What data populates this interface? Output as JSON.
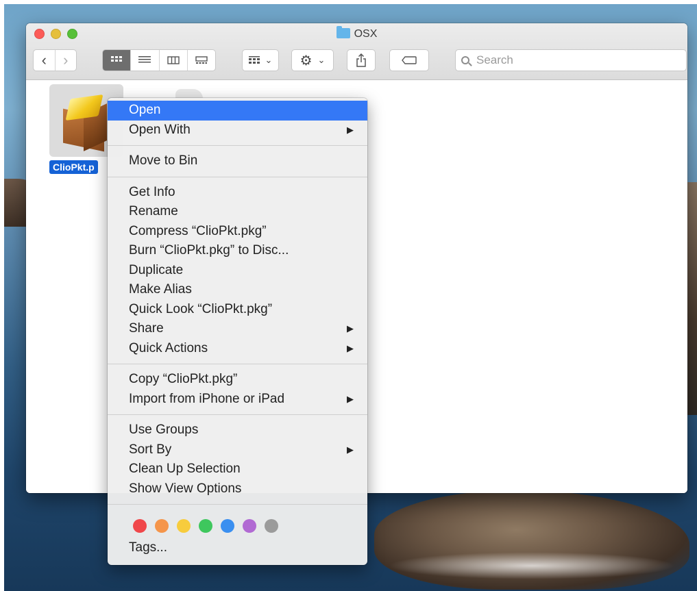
{
  "window": {
    "title": "OSX",
    "search_placeholder": "Search"
  },
  "toolbar": {
    "back": "‹",
    "forward": "›",
    "view_modes": [
      "icon-view",
      "list-view",
      "column-view",
      "gallery-view"
    ],
    "group_by_chevron": "⌄",
    "action_chevron": "⌄",
    "share_glyph": "⇪",
    "gear_glyph": "⚙"
  },
  "file": {
    "name": "ClioPkt.pkg",
    "label_visible": "ClioPkt.p"
  },
  "context_menu": {
    "open": "Open",
    "open_with": "Open With",
    "move_to_bin": "Move to Bin",
    "get_info": "Get Info",
    "rename": "Rename",
    "compress": "Compress “ClioPkt.pkg”",
    "burn": "Burn “ClioPkt.pkg” to Disc...",
    "duplicate": "Duplicate",
    "make_alias": "Make Alias",
    "quick_look": "Quick Look “ClioPkt.pkg”",
    "share": "Share",
    "quick_actions": "Quick Actions",
    "copy": "Copy “ClioPkt.pkg”",
    "import_iphone": "Import from iPhone or iPad",
    "use_groups": "Use Groups",
    "sort_by": "Sort By",
    "clean_up": "Clean Up Selection",
    "show_view_options": "Show View Options",
    "tags": "Tags...",
    "submenu_arrow": "▶",
    "tag_colors": [
      "#f0474a",
      "#f5954a",
      "#f7cc3d",
      "#3ec75d",
      "#3a8ff0",
      "#b16ad3",
      "#9b9b9b"
    ]
  }
}
